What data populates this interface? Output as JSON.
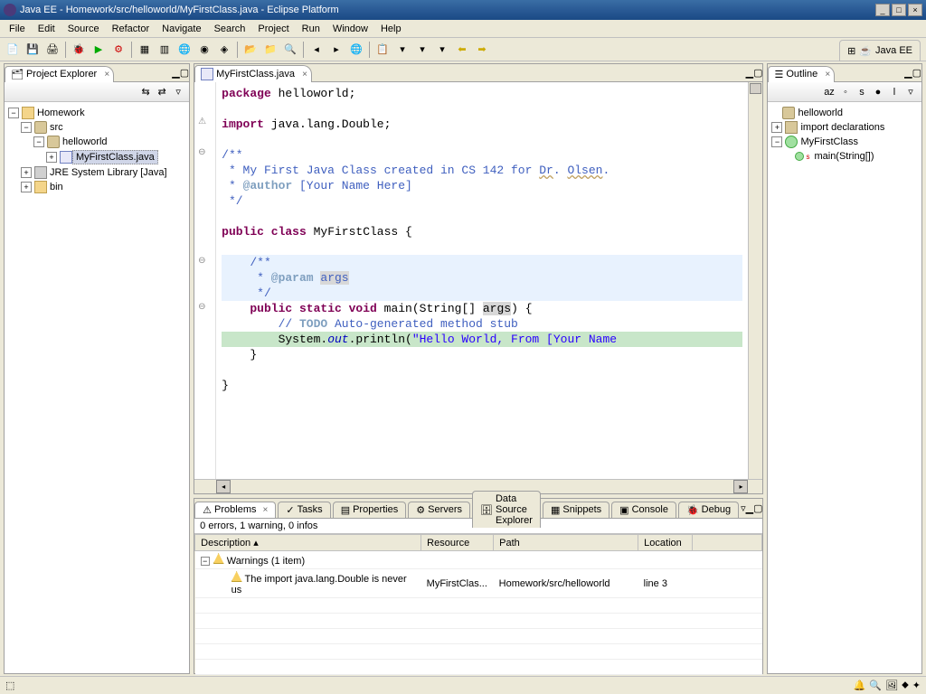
{
  "titlebar": {
    "title": "Java EE - Homework/src/helloworld/MyFirstClass.java - Eclipse Platform"
  },
  "menu": {
    "items": [
      "File",
      "Edit",
      "Source",
      "Refactor",
      "Navigate",
      "Search",
      "Project",
      "Run",
      "Window",
      "Help"
    ]
  },
  "perspective": {
    "label": "Java EE"
  },
  "projectExplorer": {
    "title": "Project Explorer",
    "tree": {
      "project": "Homework",
      "src": "src",
      "package": "helloworld",
      "file": "MyFirstClass.java",
      "jre": "JRE System Library [Java]",
      "bin": "bin"
    }
  },
  "editor": {
    "tab": "MyFirstClass.java",
    "code": {
      "l1_kw": "package",
      "l1_rest": " helloworld;",
      "l3_kw": "import",
      "l3_rest": " java.lang.Double;",
      "l5": "/**",
      "l6a": " * My First Java Class created in CS 142 for ",
      "l6b": "Dr",
      "l6c": ". ",
      "l6d": "Olsen",
      "l6e": ".",
      "l7a": " * ",
      "l7tag": "@author",
      "l7b": " [Your Name Here]",
      "l8": " */",
      "l10_kw1": "public",
      "l10_kw2": "class",
      "l10_rest": " MyFirstClass {",
      "l12": "    /**",
      "l13a": "     * ",
      "l13tag": "@param",
      "l13b": " ",
      "l13arg": "args",
      "l14": "     */",
      "l15_kw1": "public",
      "l15_kw2": "static",
      "l15_kw3": "void",
      "l15_a": " main(String[] ",
      "l15_arg": "args",
      "l15_b": ") {",
      "l16a": "        // ",
      "l16b": "TODO",
      "l16c": " Auto-generated method stub",
      "l17a": "        System.",
      "l17out": "out",
      "l17b": ".println(",
      "l17str": "\"Hello World, From [Your Name ",
      "l18": "    }",
      "l20": "}"
    }
  },
  "outline": {
    "title": "Outline",
    "items": {
      "pkg": "helloworld",
      "imports": "import declarations",
      "class": "MyFirstClass",
      "method": "main(String[])"
    }
  },
  "problems": {
    "tabs": [
      "Problems",
      "Tasks",
      "Properties",
      "Servers",
      "Data Source Explorer",
      "Snippets",
      "Console",
      "Debug"
    ],
    "summary": "0 errors, 1 warning, 0 infos",
    "columns": [
      "Description",
      "Resource",
      "Path",
      "Location"
    ],
    "group": "Warnings (1 item)",
    "row": {
      "desc": "The import java.lang.Double is never us",
      "resource": "MyFirstClas...",
      "path": "Homework/src/helloworld",
      "location": "line 3"
    }
  }
}
